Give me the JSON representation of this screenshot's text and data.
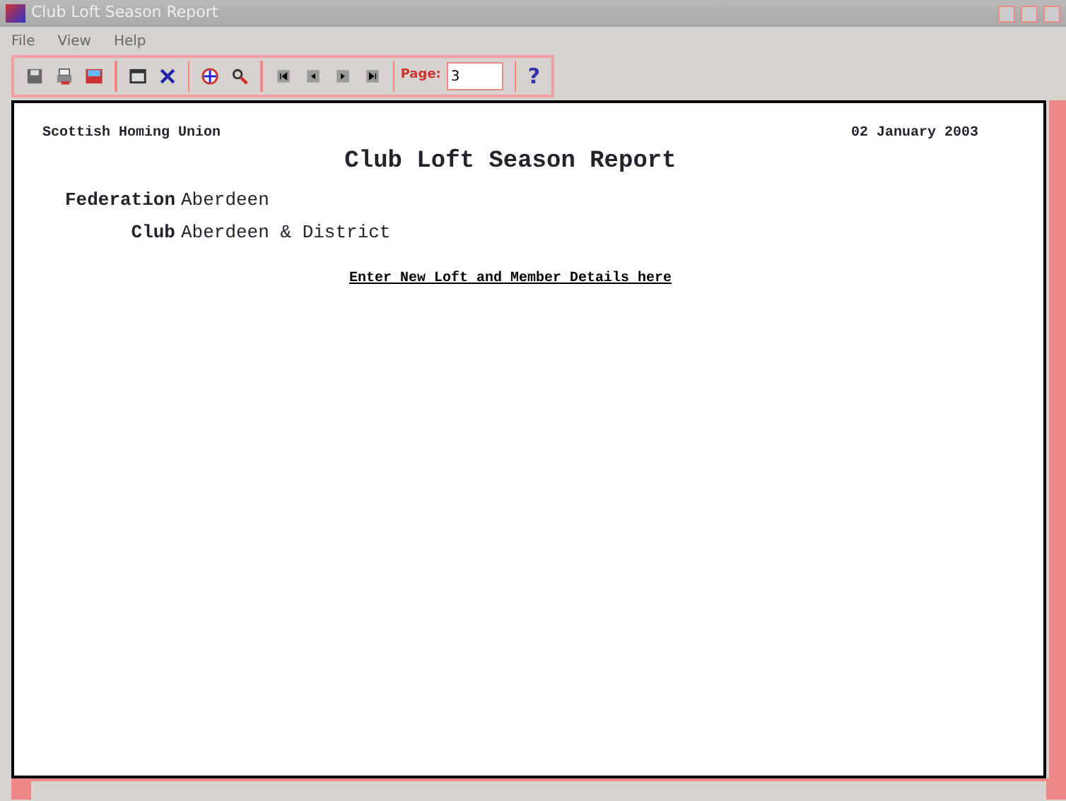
{
  "window": {
    "title": "Club Loft Season Report"
  },
  "menu": [
    "File",
    "View",
    "Help"
  ],
  "toolbar": [
    {
      "buttons": [
        {
          "kind": "save"
        },
        {
          "kind": "print"
        },
        {
          "kind": "export"
        }
      ]
    },
    {
      "buttons": [
        {
          "kind": "layout"
        },
        {
          "kind": "close"
        }
      ]
    },
    {
      "buttons": [
        {
          "kind": "zoom"
        },
        {
          "kind": "search"
        }
      ]
    },
    {
      "buttons": [
        {
          "kind": "first"
        },
        {
          "kind": "prev"
        },
        {
          "kind": "next"
        },
        {
          "kind": "last"
        }
      ]
    }
  ],
  "page_field": {
    "label": "Page:",
    "value": "3"
  },
  "help_button": "?",
  "report": {
    "organisation": "Scottish Homing Union",
    "date": "02 January 2003",
    "title": "Club Loft Season Report",
    "fields": [
      {
        "label": "Federation",
        "value": "Aberdeen"
      },
      {
        "label": "Club",
        "value": "Aberdeen & District"
      }
    ],
    "link": "Enter New Loft and Member Details here"
  }
}
